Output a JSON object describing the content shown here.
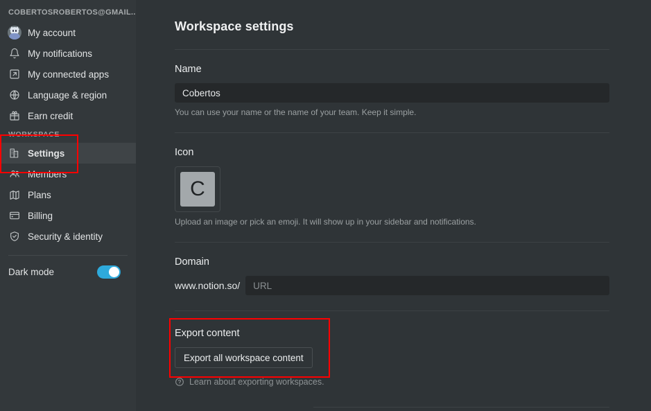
{
  "sidebar": {
    "account_email": "cobertosrobertos@gmail...",
    "account_items": [
      {
        "label": "My account",
        "icon": "avatar-icon"
      },
      {
        "label": "My notifications",
        "icon": "bell-icon"
      },
      {
        "label": "My connected apps",
        "icon": "external-link-icon"
      },
      {
        "label": "Language & region",
        "icon": "globe-icon"
      },
      {
        "label": "Earn credit",
        "icon": "gift-icon"
      }
    ],
    "workspace_section_label": "Workspace",
    "workspace_items": [
      {
        "label": "Settings",
        "icon": "building-icon",
        "active": true
      },
      {
        "label": "Members",
        "icon": "people-icon",
        "active": false
      },
      {
        "label": "Plans",
        "icon": "map-icon",
        "active": false
      },
      {
        "label": "Billing",
        "icon": "credit-card-icon",
        "active": false
      },
      {
        "label": "Security & identity",
        "icon": "shield-check-icon",
        "active": false
      }
    ],
    "dark_mode": {
      "label": "Dark mode",
      "enabled": true,
      "accent": "#2eaadc"
    }
  },
  "main": {
    "page_title": "Workspace settings",
    "name_section": {
      "label": "Name",
      "value": "Cobertos",
      "placeholder": "",
      "hint": "You can use your name or the name of your team. Keep it simple."
    },
    "icon_section": {
      "label": "Icon",
      "tile_letter": "C",
      "hint": "Upload an image or pick an emoji. It will show up in your sidebar and notifications."
    },
    "domain_section": {
      "label": "Domain",
      "prefix": "www.notion.so/",
      "value": "",
      "placeholder": "URL"
    },
    "export_section": {
      "label": "Export content",
      "button_label": "Export all workspace content",
      "learn_label": "Learn about exporting workspaces.",
      "learn_icon": "question-circle-icon"
    }
  },
  "highlights": {
    "color": "#ff0000"
  }
}
